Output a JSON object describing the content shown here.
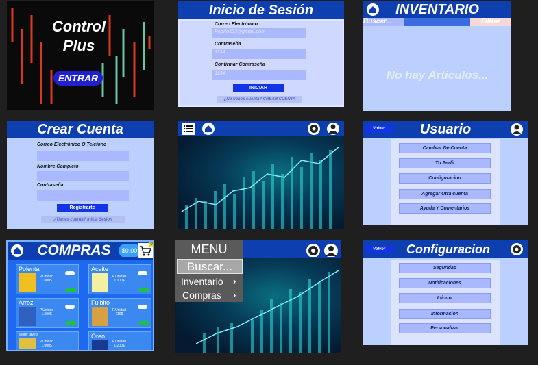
{
  "splash": {
    "title1": "Control",
    "title2": "Plus",
    "enter": "ENTRAR"
  },
  "login": {
    "title": "Inicio de Sesión",
    "email_label": "Correo Electrónico",
    "email_value": "Pepito123@gmail.com",
    "password_label": "Contraseña",
    "password_value": "1234",
    "confirm_label": "Confirmar Contraseña",
    "confirm_value": "1234",
    "submit": "INICIAR",
    "no_account": "¿No tienes cuenta?  CREAR CUENTA"
  },
  "inventory": {
    "title": "INVENTARIO",
    "search_placeholder": "Buscar...",
    "filter": "Filtrar",
    "empty": "No hay Articulos..."
  },
  "create_account": {
    "title": "Crear Cuenta",
    "email_label": "Correo Electrónico O Telefono",
    "name_label": "Nombre Completo",
    "password_label": "Contraseña",
    "submit": "Registrarte",
    "have_account": "¿Tienes cuenta? Inicia Sesion"
  },
  "user": {
    "back": "Volver",
    "title": "Usuario",
    "options": [
      "Cambiar De Cuenta",
      "Tu Perfil",
      "Configuracion",
      "Agregar Otra cuenta",
      "Ayuda Y Comentarios"
    ]
  },
  "purchases": {
    "title": "COMPRAS",
    "total": "$0.00",
    "cart_count": "0",
    "products": [
      {
        "name": "Polenta",
        "price": "P.Unidad\n1.000$"
      },
      {
        "name": "Aceite",
        "price": "P.Unidad\n1.000$"
      },
      {
        "name": "Arroz",
        "price": "P.Unidad\n1.500$"
      },
      {
        "name": "Fulbito",
        "price": "P.Unidad\n110$"
      },
      {
        "name": "afeiter tave s",
        "price": "P.Unidad\n1.000$"
      },
      {
        "name": "Oreo",
        "price": "P.Unidad\n1.200$"
      }
    ]
  },
  "menu": {
    "title": "MENU",
    "search": "Buscar...",
    "items": [
      "Inventario",
      "Compras"
    ]
  },
  "config": {
    "back": "Volver",
    "title": "Configuracion",
    "options": [
      "Seguridad",
      "Notificaciones",
      "Idioma",
      "Informacion",
      "Personalizar"
    ]
  },
  "colors": {
    "header": "#0d3fb0",
    "panel_bg": "#cfd8ff",
    "field": "#a9b8ff",
    "accent": "#1234e6"
  }
}
